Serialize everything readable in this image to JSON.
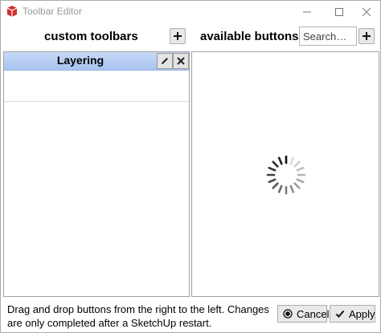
{
  "window": {
    "title": "Toolbar Editor",
    "accent_color": "#c0392b",
    "controls": {
      "minimize": "—",
      "maximize": "☐",
      "close": "✕"
    }
  },
  "header": {
    "left_title": "custom toolbars",
    "right_title": "available buttons",
    "search_placeholder": "Search…"
  },
  "custom_toolbars": {
    "items": [
      {
        "label": "Layering",
        "selected": true
      }
    ],
    "selected_color": "#b9cff5"
  },
  "available_buttons": {
    "loading": true
  },
  "footer": {
    "message": "Drag and drop buttons from the right to the left. Changes are only completed after a SketchUp restart.",
    "cancel_label": "Cancel",
    "apply_label": "Apply"
  }
}
